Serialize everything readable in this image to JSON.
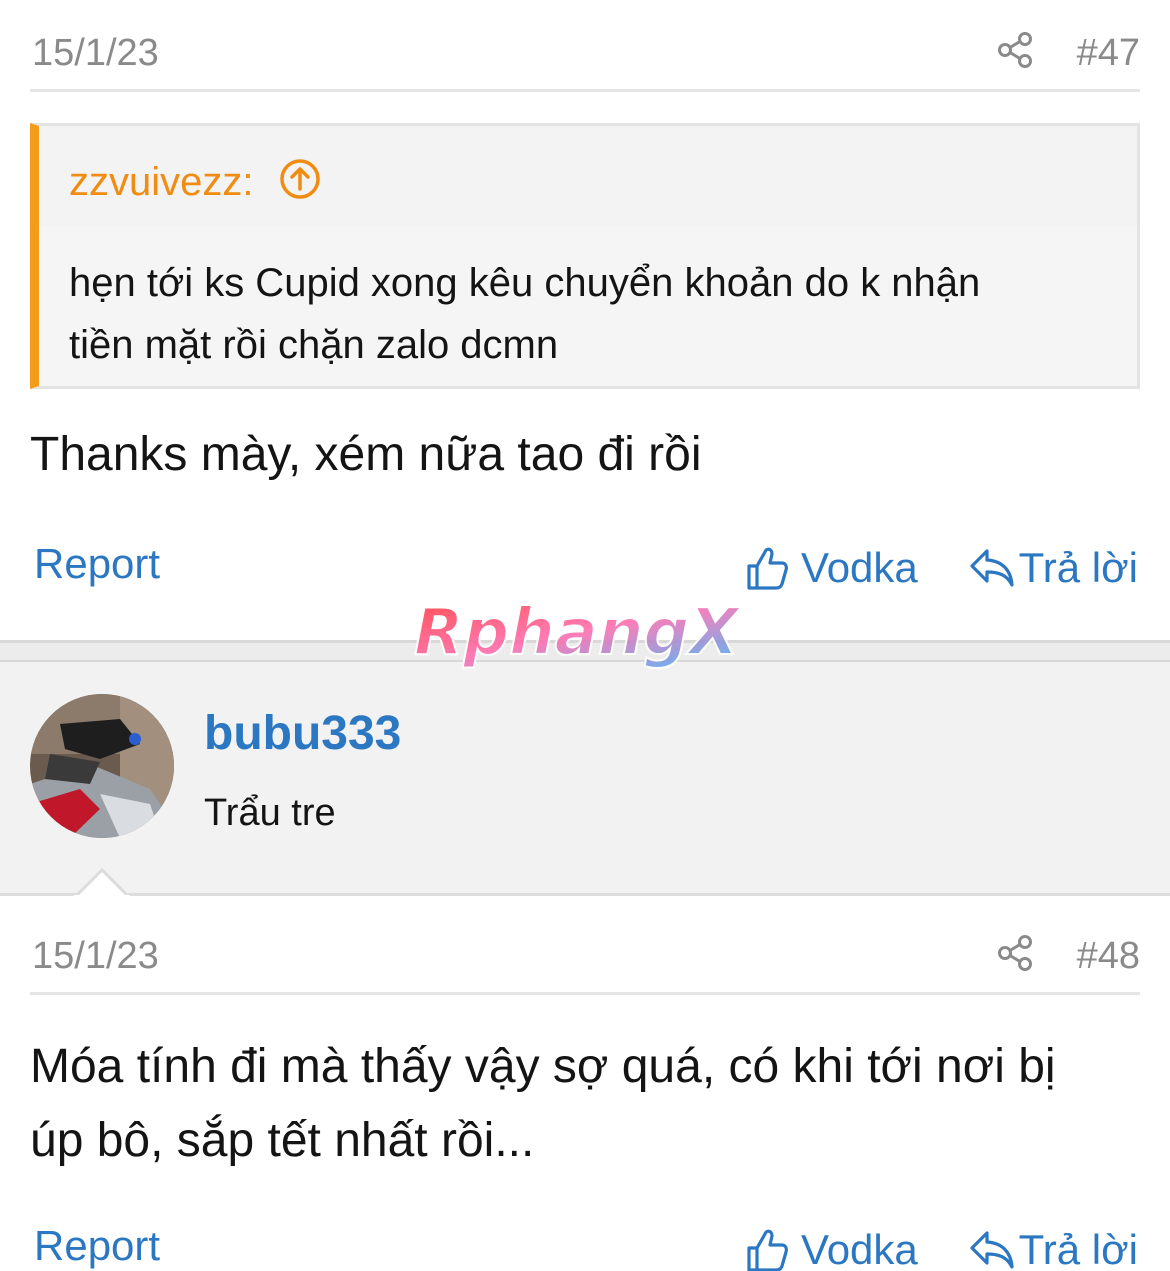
{
  "post47": {
    "date": "15/1/23",
    "number": "#47",
    "quote": {
      "author": "zzvuivezz:",
      "line1": "hẹn tới ks Cupid xong kêu chuyển khoản do k nhận",
      "line2": "tiền mặt rồi chặn zalo dcmn"
    },
    "text": "Thanks mày, xém nữa tao đi rồi",
    "actions": {
      "report": "Report",
      "react": "Vodka",
      "reply": "Trả lời"
    }
  },
  "watermark": "RphangX",
  "user48": {
    "username": "bubu333",
    "title": "Trẩu tre"
  },
  "post48": {
    "date": "15/1/23",
    "number": "#48",
    "line1": "Móa tính đi mà thấy vậy sợ quá, có khi tới nơi bị",
    "line2": "úp bô, sắp tết nhất rồi...",
    "actions": {
      "report": "Report",
      "react": "Vodka",
      "reply": "Trả lời"
    }
  },
  "colors": {
    "accent": "#2b77c2",
    "quote_border": "#f39c1a",
    "quote_author": "#f08c12",
    "meta": "#8a8a8a"
  },
  "icons": [
    "share-icon",
    "arrow-up-circle-icon",
    "thumbs-up-icon",
    "reply-icon"
  ]
}
